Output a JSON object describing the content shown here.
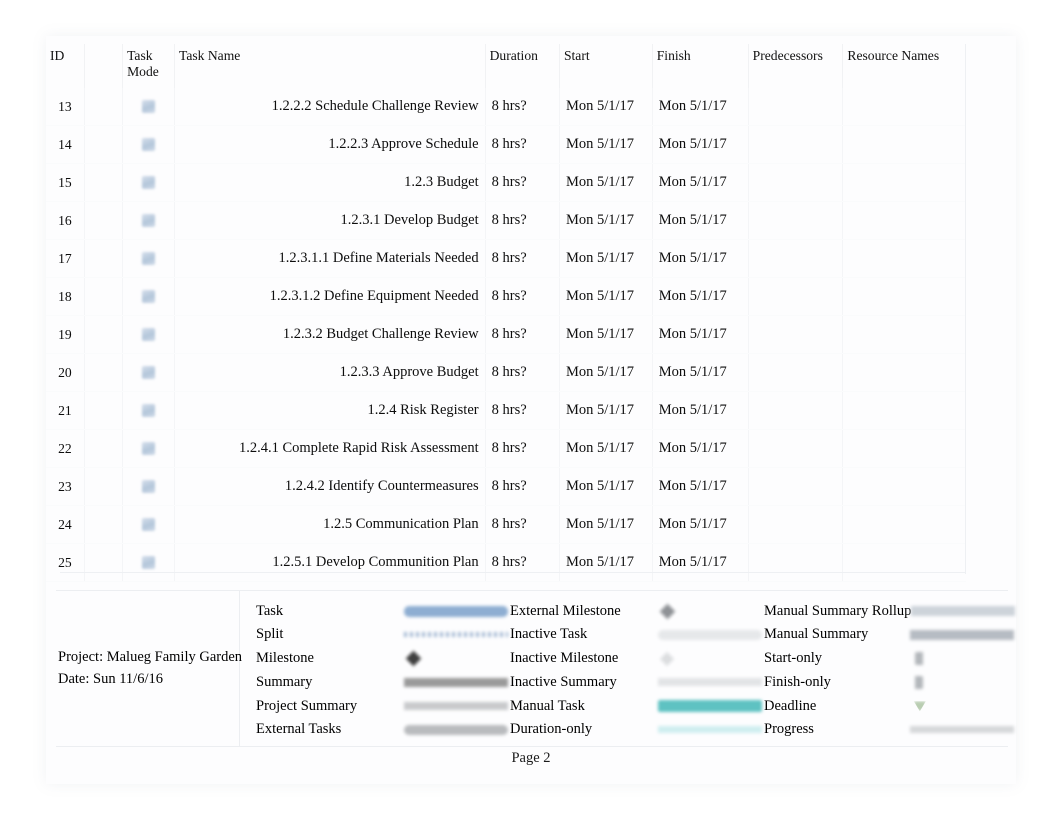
{
  "document": {
    "type": "gantt-chart-task-table",
    "page_label": "Page 2"
  },
  "table": {
    "columns": [
      {
        "key": "id",
        "label": "ID"
      },
      {
        "key": "indicator",
        "label": ""
      },
      {
        "key": "mode",
        "label": "Task Mode"
      },
      {
        "key": "name",
        "label": "Task Name"
      },
      {
        "key": "duration",
        "label": "Duration"
      },
      {
        "key": "start",
        "label": "Start"
      },
      {
        "key": "finish",
        "label": "Finish"
      },
      {
        "key": "pred",
        "label": "Predecessors"
      },
      {
        "key": "res",
        "label": "Resource Names"
      }
    ],
    "header": {
      "id": "ID",
      "task_mode_line1": "Task",
      "task_mode_line2": "Mode",
      "task_name": "Task Name",
      "duration": "Duration",
      "start": "Start",
      "finish": "Finish",
      "predecessors": "Predecessors",
      "resource_names": "Resource Names"
    },
    "rows": [
      {
        "id": "13",
        "name": "1.2.2.2 Schedule Challenge Review",
        "duration": "8 hrs?",
        "start": "Mon 5/1/17",
        "finish": "Mon 5/1/17",
        "pred": "",
        "res": ""
      },
      {
        "id": "14",
        "name": "1.2.2.3 Approve Schedule",
        "duration": "8 hrs?",
        "start": "Mon 5/1/17",
        "finish": "Mon 5/1/17",
        "pred": "",
        "res": ""
      },
      {
        "id": "15",
        "name": "1.2.3 Budget",
        "duration": "8 hrs?",
        "start": "Mon 5/1/17",
        "finish": "Mon 5/1/17",
        "pred": "",
        "res": ""
      },
      {
        "id": "16",
        "name": "1.2.3.1 Develop Budget",
        "duration": "8 hrs?",
        "start": "Mon 5/1/17",
        "finish": "Mon 5/1/17",
        "pred": "",
        "res": ""
      },
      {
        "id": "17",
        "name": "1.2.3.1.1 Define Materials Needed",
        "duration": "8 hrs?",
        "start": "Mon 5/1/17",
        "finish": "Mon 5/1/17",
        "pred": "",
        "res": ""
      },
      {
        "id": "18",
        "name": "1.2.3.1.2 Define Equipment Needed",
        "duration": "8 hrs?",
        "start": "Mon 5/1/17",
        "finish": "Mon 5/1/17",
        "pred": "",
        "res": ""
      },
      {
        "id": "19",
        "name": "1.2.3.2 Budget Challenge Review",
        "duration": "8 hrs?",
        "start": "Mon 5/1/17",
        "finish": "Mon 5/1/17",
        "pred": "",
        "res": ""
      },
      {
        "id": "20",
        "name": "1.2.3.3 Approve Budget",
        "duration": "8 hrs?",
        "start": "Mon 5/1/17",
        "finish": "Mon 5/1/17",
        "pred": "",
        "res": ""
      },
      {
        "id": "21",
        "name": "1.2.4 Risk Register",
        "duration": "8 hrs?",
        "start": "Mon 5/1/17",
        "finish": "Mon 5/1/17",
        "pred": "",
        "res": ""
      },
      {
        "id": "22",
        "name": "1.2.4.1 Complete Rapid Risk Assessment",
        "duration": "8 hrs?",
        "start": "Mon 5/1/17",
        "finish": "Mon 5/1/17",
        "pred": "",
        "res": ""
      },
      {
        "id": "23",
        "name": "1.2.4.2 Identify Countermeasures",
        "duration": "8 hrs?",
        "start": "Mon 5/1/17",
        "finish": "Mon 5/1/17",
        "pred": "",
        "res": ""
      },
      {
        "id": "24",
        "name": "1.2.5 Communication Plan",
        "duration": "8 hrs?",
        "start": "Mon 5/1/17",
        "finish": "Mon 5/1/17",
        "pred": "",
        "res": ""
      },
      {
        "id": "25",
        "name": "1.2.5.1 Develop Communition Plan",
        "duration": "8 hrs?",
        "start": "Mon 5/1/17",
        "finish": "Mon 5/1/17",
        "pred": "",
        "res": ""
      }
    ]
  },
  "legend": {
    "project_line": "Project: Malueg Family Garden",
    "date_line": "Date: Sun 11/6/16",
    "columns": [
      {
        "items": [
          {
            "label": "Task",
            "swatch": "sw-task",
            "color": "#8eaed2"
          },
          {
            "label": "Split",
            "swatch": "sw-split",
            "color": "#9fb6d2"
          },
          {
            "label": "Milestone",
            "swatch": "sw-milestone",
            "color": "#3f3f3f"
          },
          {
            "label": "Summary",
            "swatch": "sw-summary",
            "color": "#9a9a9a"
          },
          {
            "label": "Project Summary",
            "swatch": "sw-projsum",
            "color": "#c9cacc"
          },
          {
            "label": "External Tasks",
            "swatch": "sw-external",
            "color": "#b9bbbe"
          }
        ]
      },
      {
        "items": [
          {
            "label": "External Milestone",
            "swatch": "sw-extmile",
            "color": "#8f9296"
          },
          {
            "label": "Inactive Task",
            "swatch": "sw-inactask",
            "color": "#e6e8ea"
          },
          {
            "label": "Inactive Milestone",
            "swatch": "sw-inacmile",
            "color": "#dcdee0"
          },
          {
            "label": "Inactive Summary",
            "swatch": "sw-inacsum",
            "color": "#e2e4e6"
          },
          {
            "label": "Manual Task",
            "swatch": "sw-manual",
            "color": "#5ec2c2"
          },
          {
            "label": "Duration-only",
            "swatch": "sw-duronly",
            "color": "#cfeef0"
          }
        ]
      },
      {
        "items": [
          {
            "label": "Manual Summary Rollup",
            "swatch": "sw-msr",
            "color": "#cdd3da"
          },
          {
            "label": "Manual Summary",
            "swatch": "sw-msum",
            "color": "#b6bcc3"
          },
          {
            "label": "Start-only",
            "swatch": "sw-start",
            "color": "#b3b7bb"
          },
          {
            "label": "Finish-only",
            "swatch": "sw-finish",
            "color": "#b3b7bb"
          },
          {
            "label": "Deadline",
            "swatch": "sw-deadline",
            "color": "#b9cdb2"
          },
          {
            "label": "Progress",
            "swatch": "sw-progress",
            "color": "#d6d8da"
          }
        ]
      }
    ]
  },
  "footer": {
    "page": "Page 2"
  }
}
